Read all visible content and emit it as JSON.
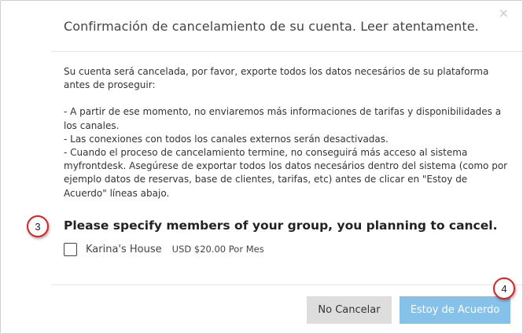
{
  "dialog": {
    "title": "Confirmación de cancelamiento de su cuenta. Leer atentamente.",
    "close_icon": "×",
    "paragraphs": [
      "Su cuenta será cancelada, por favor, exporte todos los datos necesários de su plataforma antes de proseguir:",
      "- A partir de ese momento, no enviaremos más informaciones de tarifas y disponibilidades a los canales.",
      "- Las conexiones con todos los canales externos serán desactivadas.",
      "- Cuando el proceso de cancelamiento termine, no conseguirá más acceso al sistema myfrontdesk. Asegúrese de exportar todos los datos necesários dentro del sistema (como por ejemplo datos de reservas, base de clientes, tarifas, etc) antes de clicar en \"Estoy de Acuerdo\" líneas abajo."
    ],
    "group_heading": "Please specify members of your group, you planning to cancel.",
    "member": {
      "name": "Karina's House",
      "price": "USD $20.00 Por Mes",
      "checked": false
    },
    "buttons": {
      "cancel": "No Cancelar",
      "agree": "Estoy de Acuerdo"
    }
  },
  "markers": {
    "step3": "3",
    "step4": "4"
  },
  "colors": {
    "agree_button": "#86c1ea",
    "cancel_button": "#dddddd",
    "marker_ring": "#e02020"
  }
}
